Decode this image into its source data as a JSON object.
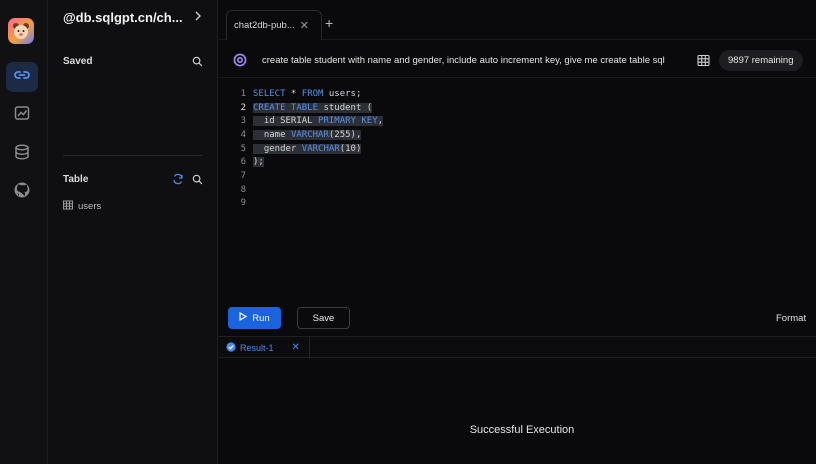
{
  "sidebar_rail": {
    "logo_icon": "bear-logo-icon",
    "items": [
      {
        "name": "connections",
        "icon": "link-icon",
        "active": true
      },
      {
        "name": "dashboard",
        "icon": "chart-icon",
        "active": false
      },
      {
        "name": "database",
        "icon": "database-icon",
        "active": false
      },
      {
        "name": "github",
        "icon": "github-icon",
        "active": false
      }
    ]
  },
  "panel": {
    "connection_title": "@db.sqlgpt.cn/ch...",
    "saved_title": "Saved",
    "table_title": "Table",
    "tables": [
      {
        "label": "users"
      }
    ]
  },
  "tabs": [
    {
      "label": "chat2db-pub..."
    }
  ],
  "prompt": {
    "text": "create table student with name and gender, include auto increment key, give me create table sql",
    "remaining": "9897 remaining"
  },
  "editor": {
    "line_numbers": [
      "1",
      "2",
      "3",
      "4",
      "5",
      "6",
      "7",
      "8",
      "9"
    ]
  },
  "toolbar": {
    "run_label": "Run",
    "save_label": "Save",
    "format_label": "Format"
  },
  "result": {
    "tab_label": "Result-1",
    "status": "Successful Execution"
  },
  "colors": {
    "accent": "#1a64e0",
    "keyword": "#5a8fe8",
    "background": "#0a0a0c"
  }
}
